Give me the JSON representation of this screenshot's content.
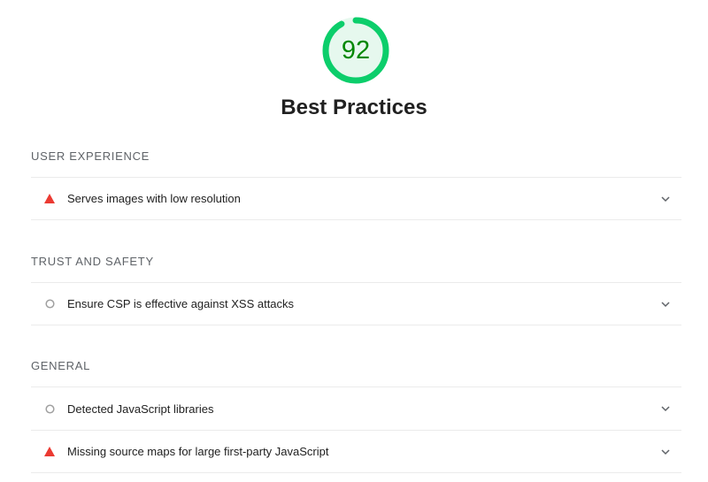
{
  "gauge": {
    "score": "92",
    "fraction": 0.92,
    "color": "#0cce6b",
    "text_color": "#008800",
    "bg_color": "#e6f8ee"
  },
  "category": {
    "title": "Best Practices"
  },
  "sections": [
    {
      "title": "User Experience",
      "audits": [
        {
          "label": "Serves images with low resolution",
          "status": "fail",
          "icon": "warning-triangle-icon"
        }
      ]
    },
    {
      "title": "Trust and Safety",
      "audits": [
        {
          "label": "Ensure CSP is effective against XSS attacks",
          "status": "informative",
          "icon": "circle-icon"
        }
      ]
    },
    {
      "title": "General",
      "audits": [
        {
          "label": "Detected JavaScript libraries",
          "status": "informative",
          "icon": "circle-icon"
        },
        {
          "label": "Missing source maps for large first-party JavaScript",
          "status": "fail",
          "icon": "warning-triangle-icon"
        }
      ]
    }
  ],
  "colors": {
    "fail": "#eb3a32",
    "informative": "#a0a0a0",
    "divider": "#ebebeb"
  }
}
